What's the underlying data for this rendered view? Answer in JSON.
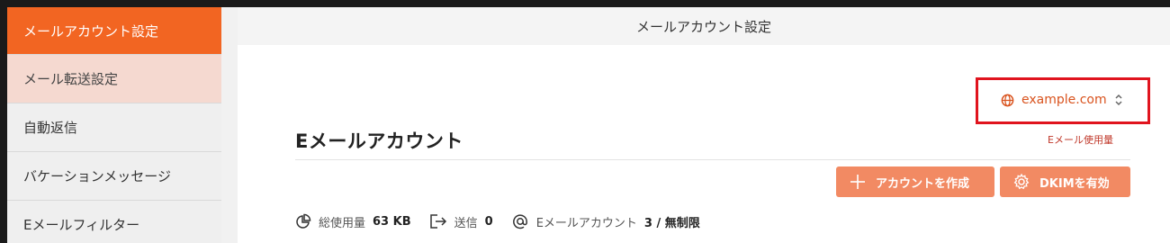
{
  "sidebar": {
    "items": [
      {
        "label": "メールアカウント設定"
      },
      {
        "label": "メール転送設定"
      },
      {
        "label": "自動返信"
      },
      {
        "label": "バケーションメッセージ"
      },
      {
        "label": "Eメールフィルター"
      }
    ]
  },
  "header": {
    "title": "メールアカウント設定"
  },
  "domain": {
    "value": "example.com"
  },
  "usage_link": "Eメール使用量",
  "section": {
    "title": "Eメールアカウント"
  },
  "buttons": {
    "create": "アカウントを作成",
    "dkim": "DKIMを有効"
  },
  "stats": {
    "total_label": "総使用量",
    "total_value": "63 KB",
    "sent_label": "送信",
    "sent_value": "0",
    "accounts_label": "Eメールアカウント",
    "accounts_value": "3 / 無制限"
  },
  "colors": {
    "accent": "#f26522",
    "button": "#f28a63",
    "highlight": "#e0141e"
  }
}
